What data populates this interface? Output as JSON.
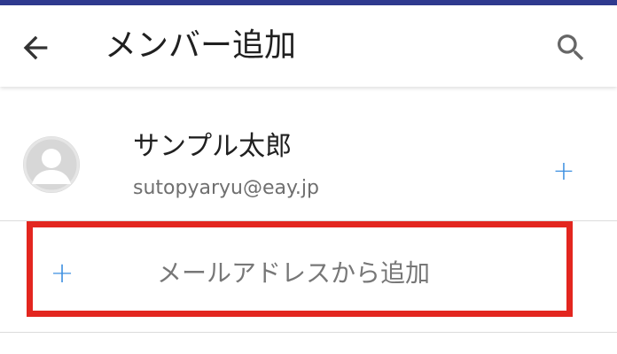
{
  "header": {
    "title": "メンバー追加",
    "back_icon": "arrow-left-icon",
    "search_icon": "search-icon"
  },
  "member": {
    "name": "サンプル太郎",
    "email": "sutopyaryu@eay.jp",
    "avatar_icon": "person-icon",
    "add_symbol": "+"
  },
  "email_add": {
    "symbol": "+",
    "label": "メールアドレスから追加"
  },
  "colors": {
    "accent": "#3d8fe0",
    "highlight": "#e3261f",
    "top_bar": "#2f3a8f"
  }
}
